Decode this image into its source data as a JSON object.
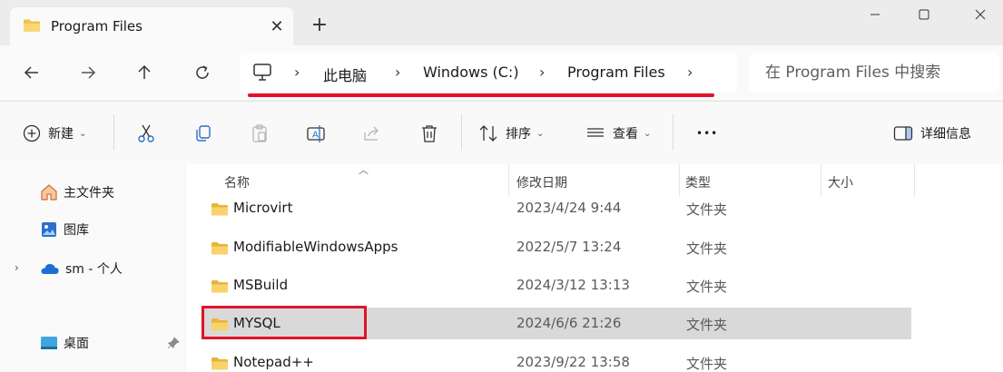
{
  "window": {
    "tab_title": "Program Files",
    "tab_close": "✕",
    "new_tab": "+"
  },
  "address": {
    "crumbs": [
      "此电脑",
      "Windows (C:)",
      "Program Files"
    ],
    "separator": "›"
  },
  "search": {
    "placeholder": "在 Program Files 中搜索"
  },
  "toolbar": {
    "new_label": "新建",
    "sort_label": "排序",
    "view_label": "查看",
    "more_label": "•••",
    "details_label": "详细信息"
  },
  "sidebar": {
    "items": [
      {
        "label": "主文件夹",
        "icon": "home-icon"
      },
      {
        "label": "图库",
        "icon": "gallery-icon"
      },
      {
        "label": "sm - 个人",
        "icon": "cloud-icon"
      },
      {
        "label": "桌面",
        "icon": "desktop-icon"
      }
    ]
  },
  "columns": [
    "名称",
    "修改日期",
    "类型",
    "大小"
  ],
  "files": [
    {
      "name": "Microvirt",
      "date": "2023/4/24 9:44",
      "type": "文件夹"
    },
    {
      "name": "ModifiableWindowsApps",
      "date": "2022/5/7 13:24",
      "type": "文件夹"
    },
    {
      "name": "MSBuild",
      "date": "2024/3/12 13:13",
      "type": "文件夹"
    },
    {
      "name": "MYSQL",
      "date": "2024/6/6 21:26",
      "type": "文件夹",
      "selected": true
    },
    {
      "name": "Notepad++",
      "date": "2023/9/22 13:58",
      "type": "文件夹"
    }
  ],
  "colors": {
    "accent_red": "#e0132a",
    "folder_yellow": "#f2c14e",
    "selection": "#d9d9d9"
  }
}
